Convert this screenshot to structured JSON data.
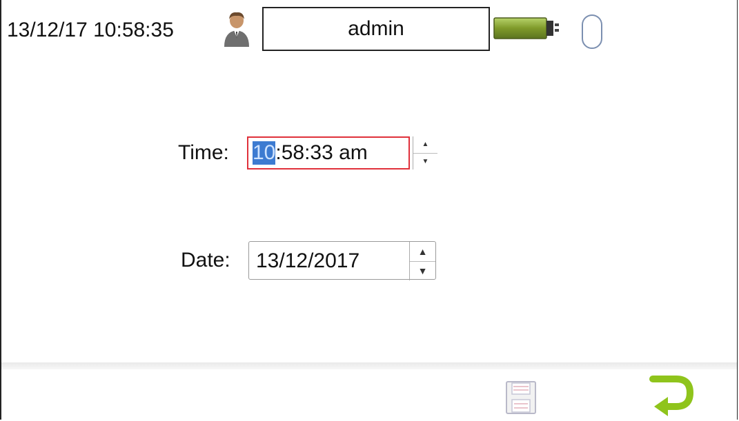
{
  "status_bar": {
    "datetime": "13/12/17 10:58:35",
    "user_icon": "user-icon",
    "username": "admin",
    "battery_icon": "battery-icon",
    "mouse_icon": "mouse-icon"
  },
  "form": {
    "time_label": "Time:",
    "time_hour_selected": "10",
    "time_rest": ":58:33 am",
    "date_label": "Date:",
    "date_value": "13/12/2017"
  },
  "footer": {
    "save_icon": "save-icon",
    "return_icon": "return-arrow-icon"
  },
  "colors": {
    "focus_border": "#e0303a",
    "selection": "#3d7bd1",
    "return_green": "#8fc41c"
  }
}
